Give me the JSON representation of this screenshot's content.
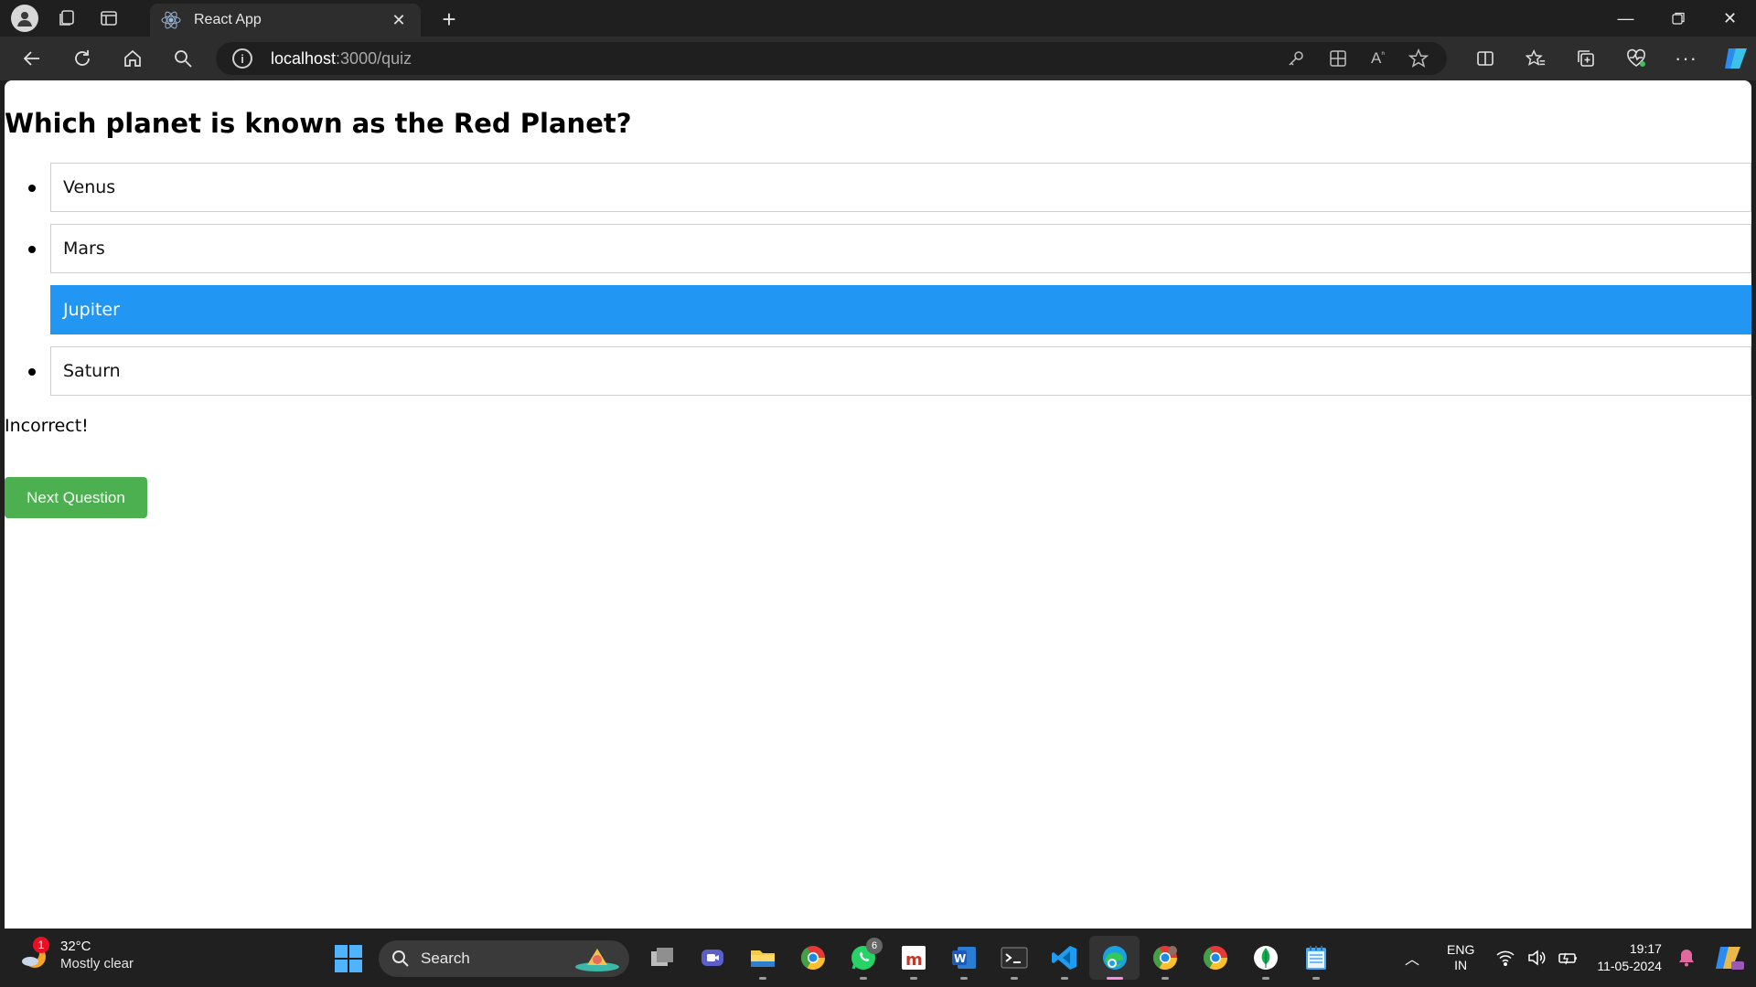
{
  "browser": {
    "tab_title": "React App",
    "url_host": "localhost",
    "url_path": ":3000/quiz",
    "icons": [
      "profile-icon",
      "workspaces-icon",
      "tab-actions-icon",
      "react-favicon",
      "close-icon",
      "plus-icon",
      "minimize-icon",
      "restore-icon",
      "close-window-icon",
      "back-icon",
      "refresh-icon",
      "home-icon",
      "search-icon",
      "info-icon",
      "key-icon",
      "apps-icon",
      "read-aloud-icon",
      "favorite-star-icon",
      "split-screen-icon",
      "favorites-icon",
      "collections-icon",
      "browser-essentials-icon",
      "more-icon",
      "copilot-icon"
    ]
  },
  "quiz": {
    "question": "Which planet is known as the Red Planet?",
    "options": [
      {
        "label": "Venus",
        "selected": false
      },
      {
        "label": "Mars",
        "selected": false
      },
      {
        "label": "Jupiter",
        "selected": true
      },
      {
        "label": "Saturn",
        "selected": false
      }
    ],
    "result": "Incorrect!",
    "next_button": "Next Question",
    "colors": {
      "selected": "#2196f3",
      "next_button": "#4caf50"
    }
  },
  "taskbar": {
    "weather_temp": "32°C",
    "weather_cond": "Mostly clear",
    "weather_badge": "1",
    "search_label": "Search",
    "whatsapp_badge": "6",
    "lang_line1": "ENG",
    "lang_line2": "IN",
    "time": "19:17",
    "date": "11-05-2024"
  }
}
